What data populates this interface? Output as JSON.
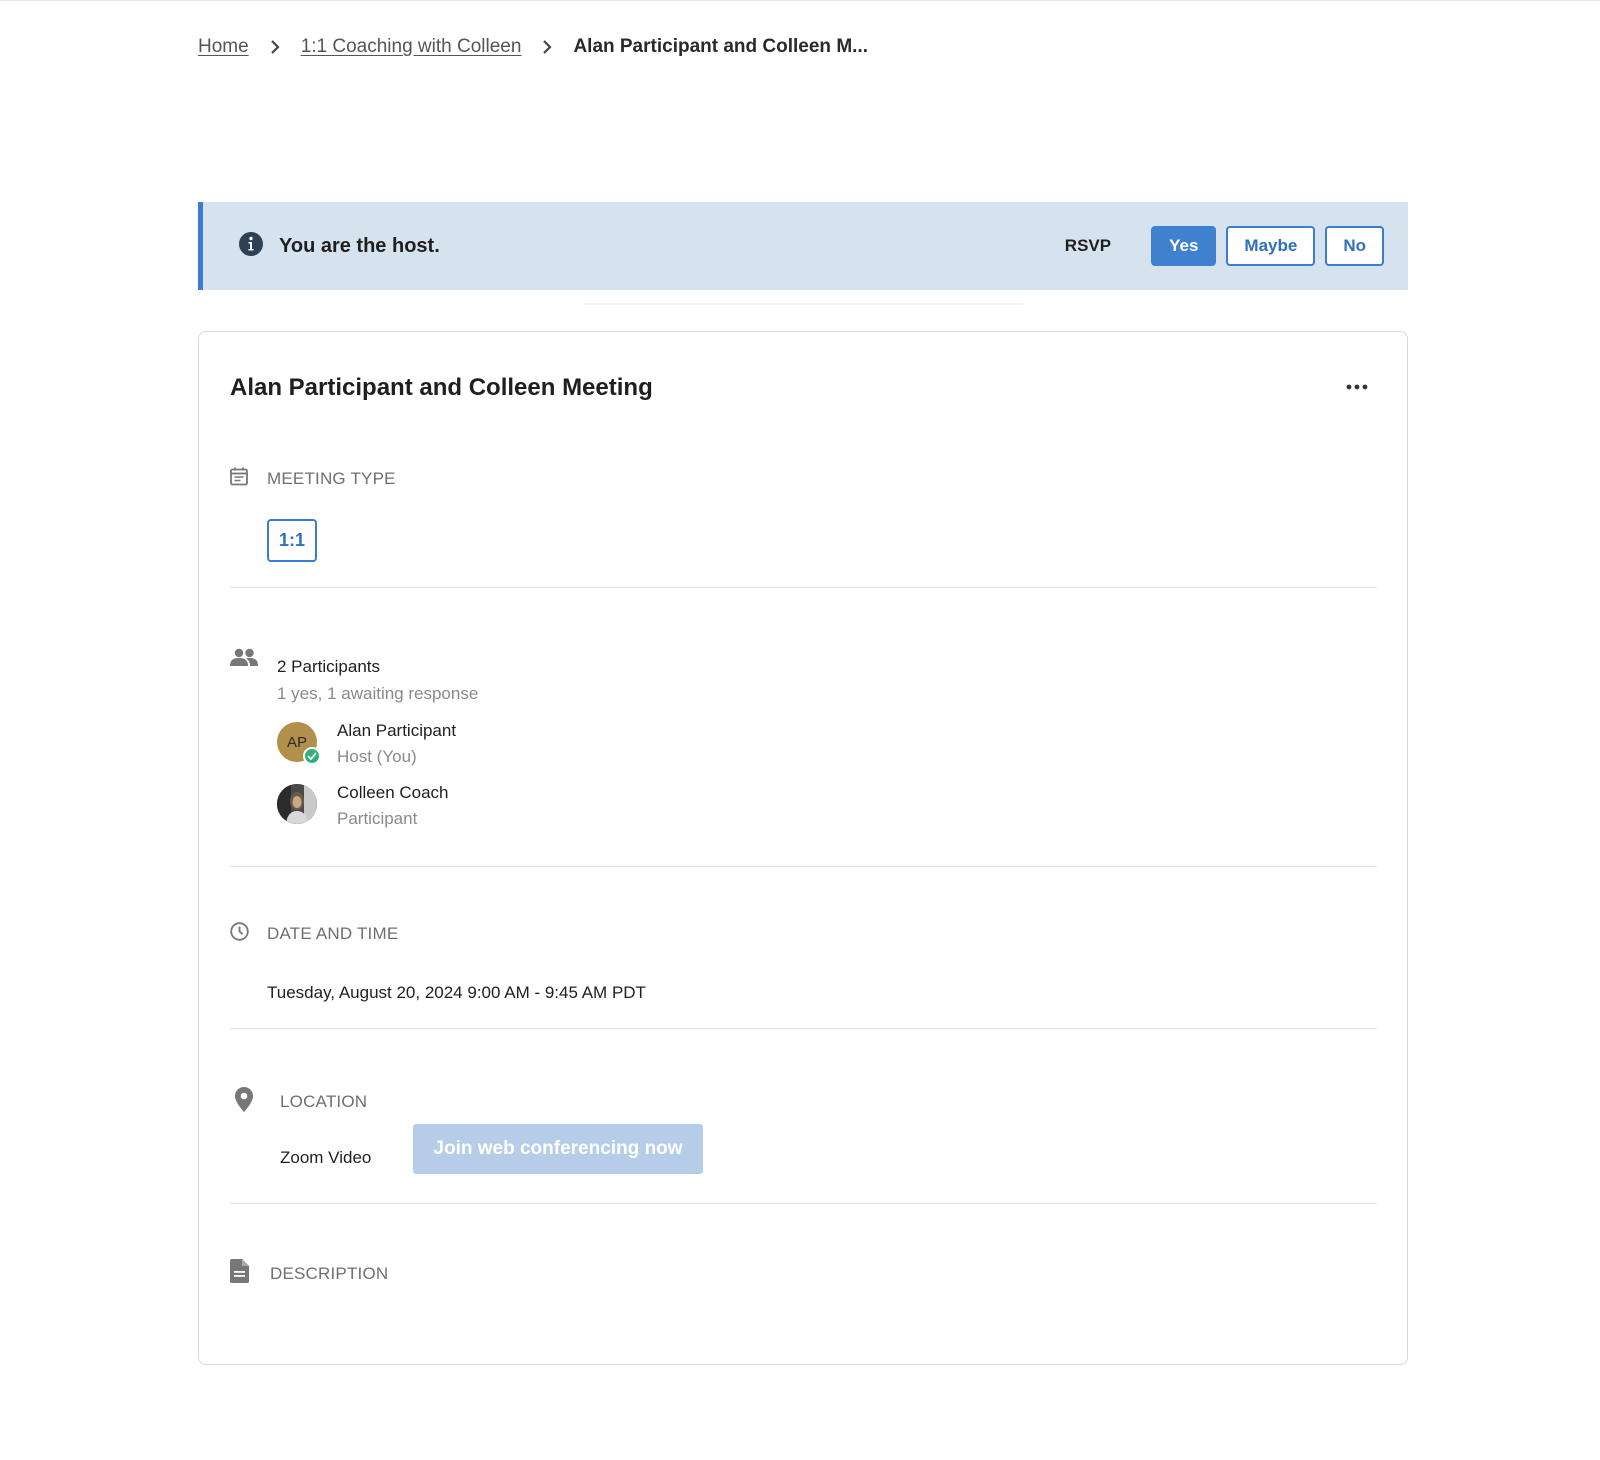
{
  "breadcrumb": {
    "home": "Home",
    "program": "1:1 Coaching with Colleen",
    "current": "Alan Participant and Colleen M..."
  },
  "banner": {
    "message": "You are the host.",
    "rsvp_label": "RSVP",
    "options": [
      "Yes",
      "Maybe",
      "No"
    ],
    "selected": "Yes"
  },
  "meeting": {
    "title": "Alan Participant and Colleen Meeting",
    "type_label": "MEETING TYPE",
    "type_value": "1:1",
    "participants_count": "2 Participants",
    "participants_summary": "1 yes, 1 awaiting response",
    "participants": [
      {
        "initials": "AP",
        "name": "Alan Participant",
        "role": "Host (You)"
      },
      {
        "initials": "",
        "name": "Colleen Coach",
        "role": "Participant"
      }
    ],
    "datetime_label": "DATE AND TIME",
    "datetime_value": "Tuesday, August 20, 2024 9:00 AM - 9:45 AM PDT",
    "location_label": "LOCATION",
    "location_value": "Zoom Video",
    "join_label": "Join web conferencing now",
    "description_label": "DESCRIPTION"
  },
  "colors": {
    "accent": "#3a7bd5",
    "banner_bg": "#d6e2ee",
    "join_disabled": "#b5cde8",
    "check_green": "#2fb37a",
    "avatar_gold": "#b0904a"
  }
}
